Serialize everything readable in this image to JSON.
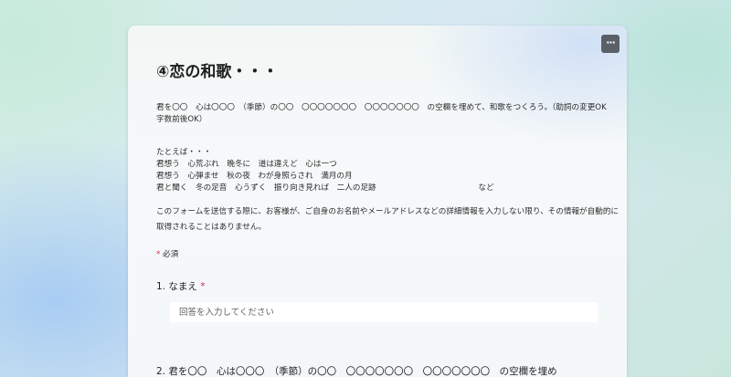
{
  "form": {
    "title": "④恋の和歌・・・",
    "more_icon": "ellipsis-icon",
    "more_label": "···",
    "description_1": "君を〇〇　心は〇〇〇　（季節）の〇〇　〇〇〇〇〇〇〇　〇〇〇〇〇〇〇　の空欄を埋めて、和歌をつくろう。（助詞の変更OK　字数前後OK）",
    "examples": [
      "たとえば・・・",
      "君想う　心荒ぶれ　晩冬に　道は違えど　心は一つ",
      "君想う　心弾ませ　秋の夜　わが身照らされ　満月の月",
      "君と聞く　冬の足音　心うずく　振り向き見れば　二人の足跡　　　　　　　　　　　　　など"
    ],
    "privacy_note": "このフォームを送信する際に、お客様が、ご自身のお名前やメールアドレスなどの詳細情報を入力しない限り、その情報が自動的に取得されることはありません。",
    "required_star": "*",
    "required_label": "必須",
    "accent_required": "#c4314b"
  },
  "questions": [
    {
      "number_label": "1. なまえ",
      "required_star": "*",
      "placeholder": "回答を入力してください"
    },
    {
      "number_label": "2. 君を〇〇　心は〇〇〇　（季節）の〇〇　〇〇〇〇〇〇〇　〇〇〇〇〇〇〇　の空欄を埋め"
    }
  ]
}
